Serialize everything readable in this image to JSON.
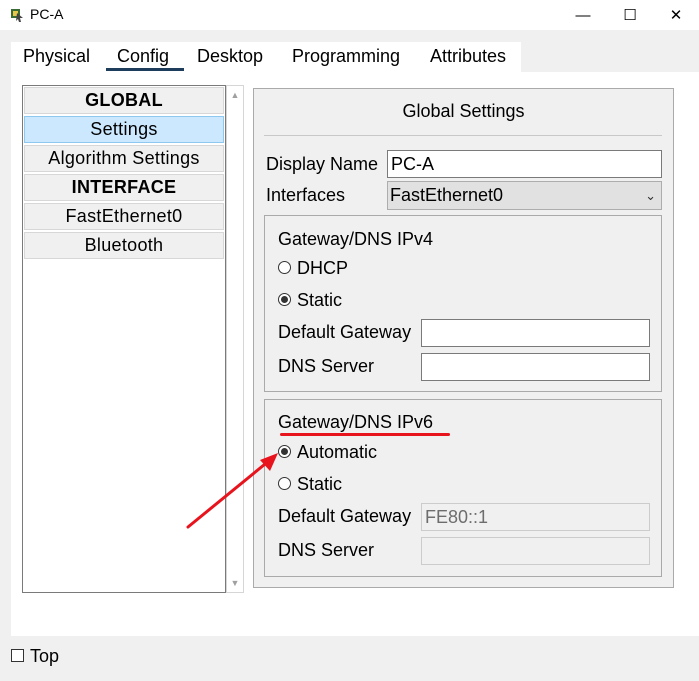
{
  "window": {
    "title": "PC-A",
    "controls": {
      "minimize": "—",
      "maximize": "☐",
      "close": "✕"
    }
  },
  "tabs": [
    {
      "label": "Physical",
      "active": false
    },
    {
      "label": "Config",
      "active": true
    },
    {
      "label": "Desktop",
      "active": false
    },
    {
      "label": "Programming",
      "active": false
    },
    {
      "label": "Attributes",
      "active": false
    }
  ],
  "sidebar": {
    "items": [
      {
        "label": "GLOBAL",
        "header": true
      },
      {
        "label": "Settings",
        "selected": true
      },
      {
        "label": "Algorithm Settings"
      },
      {
        "label": "INTERFACE",
        "header": true
      },
      {
        "label": "FastEthernet0"
      },
      {
        "label": "Bluetooth"
      }
    ],
    "scroll_up": "▲",
    "scroll_down": "▼"
  },
  "global_settings": {
    "title": "Global Settings",
    "display_name_label": "Display Name",
    "display_name_value": "PC-A",
    "interfaces_label": "Interfaces",
    "interfaces_value": "FastEthernet0",
    "chevron": "⌄"
  },
  "ipv4": {
    "title": "Gateway/DNS IPv4",
    "option_dhcp": "DHCP",
    "option_static": "Static",
    "selected": "Static",
    "default_gateway_label": "Default Gateway",
    "default_gateway_value": "",
    "dns_server_label": "DNS Server",
    "dns_server_value": ""
  },
  "ipv6": {
    "title": "Gateway/DNS IPv6",
    "option_automatic": "Automatic",
    "option_static": "Static",
    "selected": "Automatic",
    "default_gateway_label": "Default Gateway",
    "default_gateway_value": "FE80::1",
    "dns_server_label": "DNS Server",
    "dns_server_value": ""
  },
  "footer": {
    "top_label": "Top",
    "top_checked": false
  },
  "colors": {
    "annotation": "#e8141d",
    "selected_item": "#cce8ff",
    "active_tab_underline": "#1e3d5c"
  }
}
